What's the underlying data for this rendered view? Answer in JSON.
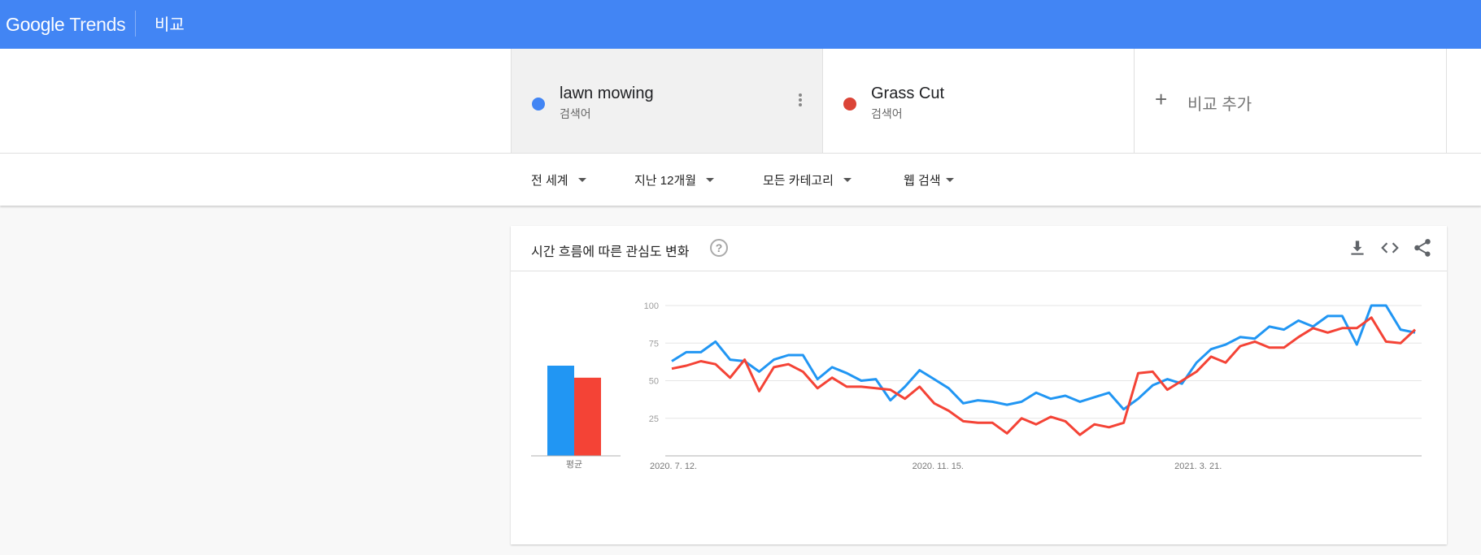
{
  "header": {
    "logo_google": "Google",
    "logo_trends": "Trends",
    "page_title": "비교"
  },
  "terms": [
    {
      "name": "lawn mowing",
      "sub": "검색어",
      "color": "#4285f4"
    },
    {
      "name": "Grass Cut",
      "sub": "검색어",
      "color": "#db4437"
    }
  ],
  "add_compare": {
    "icon": "plus-icon",
    "label": "비교 추가"
  },
  "filters": {
    "region": "전 세계",
    "period": "지난 12개월",
    "category": "모든 카테고리",
    "search_type": "웹 검색"
  },
  "card": {
    "title": "시간 흐름에 따른 관심도 변화",
    "help_icon": "question-icon",
    "help_symbol": "?",
    "tools": [
      "download-icon",
      "embed-icon",
      "share-icon"
    ]
  },
  "chart_data": {
    "type": "line",
    "ylim": [
      0,
      100
    ],
    "yticks": [
      25,
      50,
      75,
      100
    ],
    "xtick_labels": [
      "2020. 7. 12.",
      "2020. 11. 15.",
      "2021. 3. 21."
    ],
    "xtick_index": [
      0,
      18,
      36
    ],
    "grid": true,
    "series": [
      {
        "name": "lawn mowing",
        "color": "#2196f3",
        "values": [
          63,
          69,
          69,
          76,
          64,
          63,
          56,
          64,
          67,
          67,
          51,
          59,
          55,
          50,
          51,
          37,
          46,
          57,
          51,
          45,
          35,
          37,
          36,
          34,
          36,
          42,
          38,
          40,
          36,
          39,
          42,
          31,
          38,
          47,
          51,
          48,
          62,
          71,
          74,
          79,
          78,
          86,
          84,
          90,
          86,
          93,
          93,
          74,
          100,
          100,
          84,
          82
        ],
        "average": 60
      },
      {
        "name": "Grass Cut",
        "color": "#f44336",
        "values": [
          58,
          60,
          63,
          61,
          52,
          64,
          43,
          59,
          61,
          56,
          45,
          52,
          46,
          46,
          45,
          44,
          38,
          46,
          35,
          30,
          23,
          22,
          22,
          15,
          25,
          21,
          26,
          23,
          14,
          21,
          19,
          22,
          55,
          56,
          44,
          50,
          56,
          66,
          62,
          73,
          76,
          72,
          72,
          79,
          85,
          82,
          85,
          85,
          92,
          76,
          75,
          84
        ],
        "average": 52
      }
    ],
    "average_label": "평균"
  }
}
